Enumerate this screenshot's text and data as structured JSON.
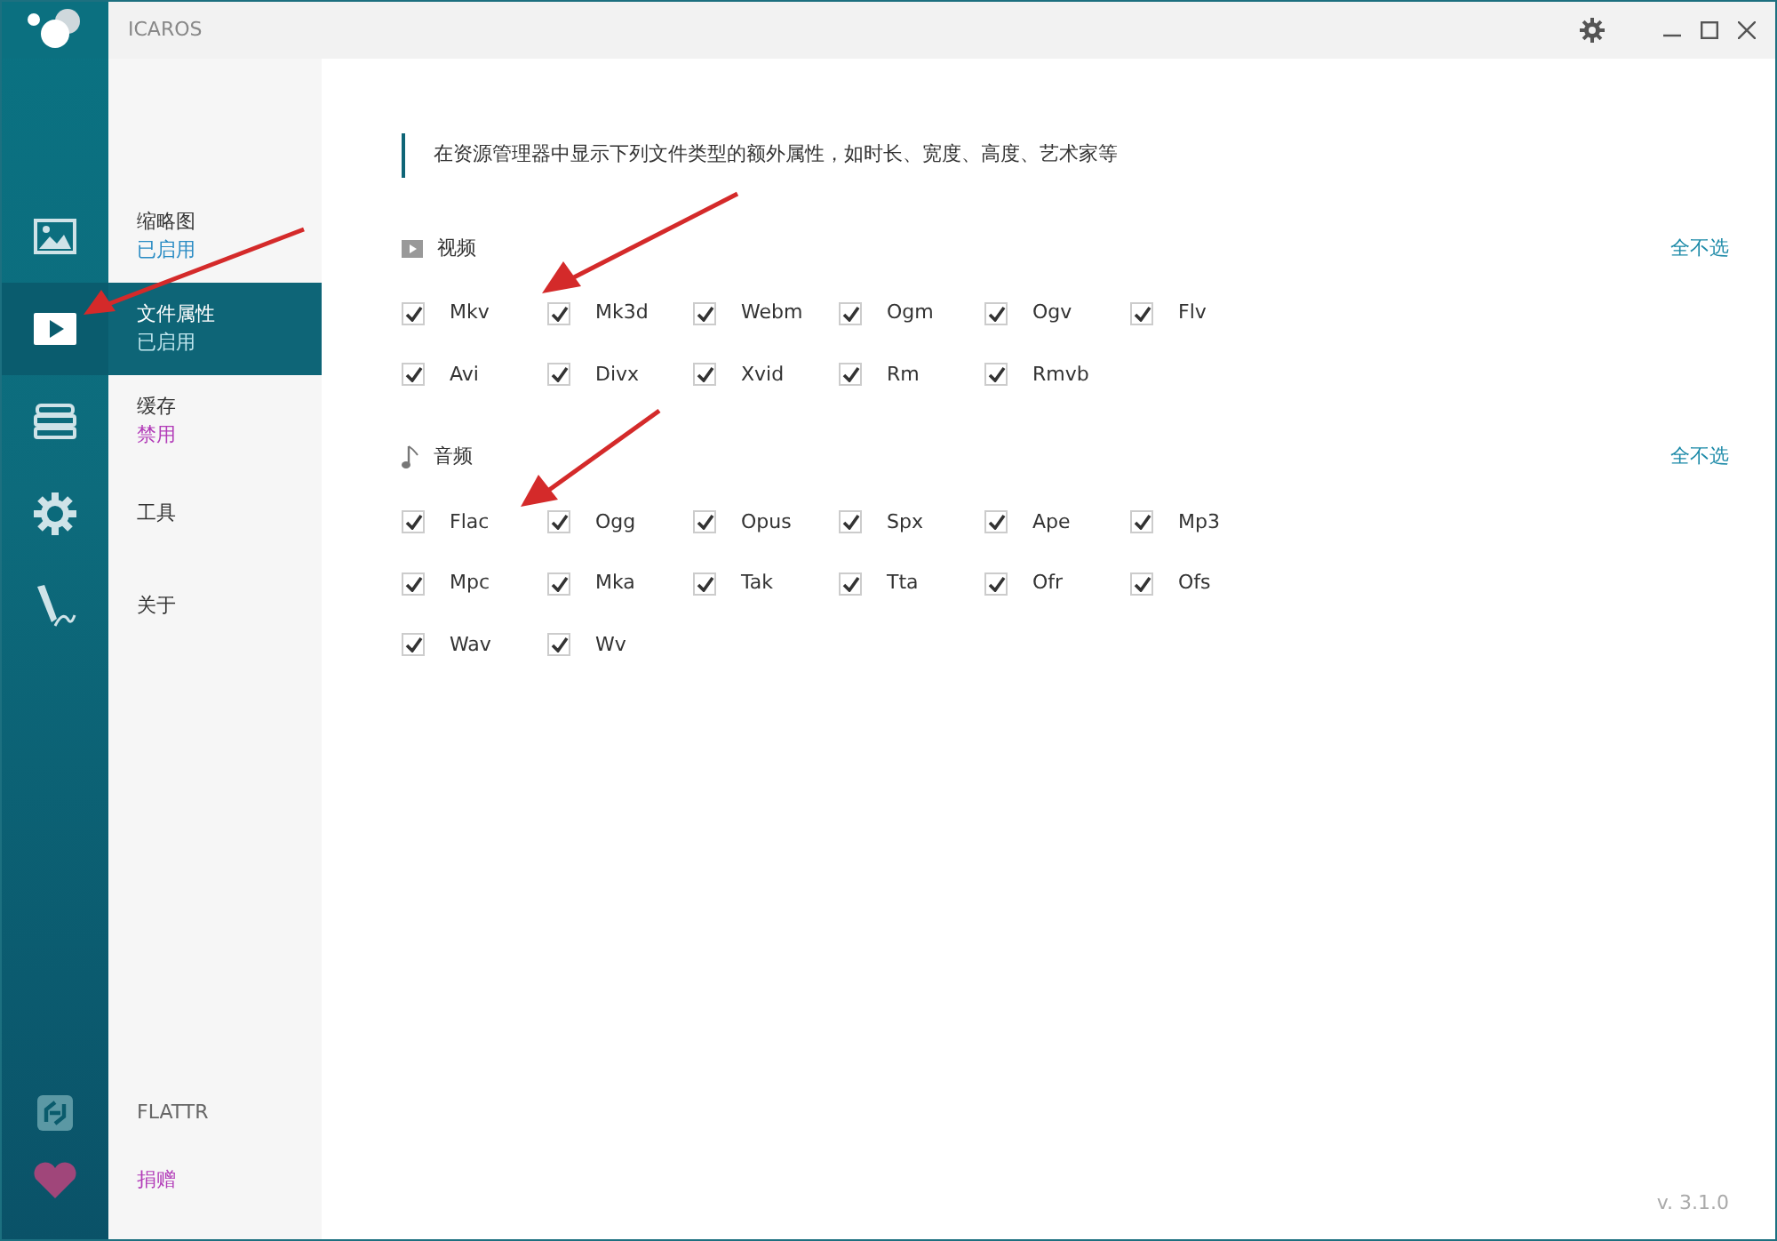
{
  "window": {
    "title": "ICAROS"
  },
  "nav": [
    {
      "label": "缩略图",
      "status": {
        "text": "已启用",
        "color": "#2a8cc4"
      },
      "selected": false
    },
    {
      "label": "文件属性",
      "status": {
        "text": "已启用",
        "color": "#bfe6ee"
      },
      "selected": true
    },
    {
      "label": "缓存",
      "status": {
        "text": "禁用",
        "color": "#b23cb8"
      },
      "selected": false
    },
    {
      "label": "工具",
      "selected": false
    },
    {
      "label": "关于",
      "selected": false
    }
  ],
  "footer_nav": [
    {
      "label": "FLATTR",
      "kind": "plain"
    },
    {
      "label": "捐赠",
      "kind": "accent"
    }
  ],
  "description": "在资源管理器中显示下列文件类型的额外属性，如时长、宽度、高度、艺术家等",
  "sections": [
    {
      "kind": "video",
      "title": "视频",
      "action": "全不选",
      "items": [
        {
          "label": "Mkv",
          "checked": true
        },
        {
          "label": "Mk3d",
          "checked": true
        },
        {
          "label": "Webm",
          "checked": true
        },
        {
          "label": "Ogm",
          "checked": true
        },
        {
          "label": "Ogv",
          "checked": true
        },
        {
          "label": "Flv",
          "checked": true
        },
        {
          "label": "Avi",
          "checked": true
        },
        {
          "label": "Divx",
          "checked": true
        },
        {
          "label": "Xvid",
          "checked": true
        },
        {
          "label": "Rm",
          "checked": true
        },
        {
          "label": "Rmvb",
          "checked": true
        }
      ]
    },
    {
      "kind": "audio",
      "title": "音频",
      "action": "全不选",
      "items": [
        {
          "label": "Flac",
          "checked": true
        },
        {
          "label": "Ogg",
          "checked": true
        },
        {
          "label": "Opus",
          "checked": true
        },
        {
          "label": "Spx",
          "checked": true
        },
        {
          "label": "Ape",
          "checked": true
        },
        {
          "label": "Mp3",
          "checked": true
        },
        {
          "label": "Mpc",
          "checked": true
        },
        {
          "label": "Mka",
          "checked": true
        },
        {
          "label": "Tak",
          "checked": true
        },
        {
          "label": "Tta",
          "checked": true
        },
        {
          "label": "Ofr",
          "checked": true
        },
        {
          "label": "Ofs",
          "checked": true
        },
        {
          "label": "Wav",
          "checked": true
        },
        {
          "label": "Wv",
          "checked": true
        }
      ]
    }
  ],
  "version": "v. 3.1.0"
}
